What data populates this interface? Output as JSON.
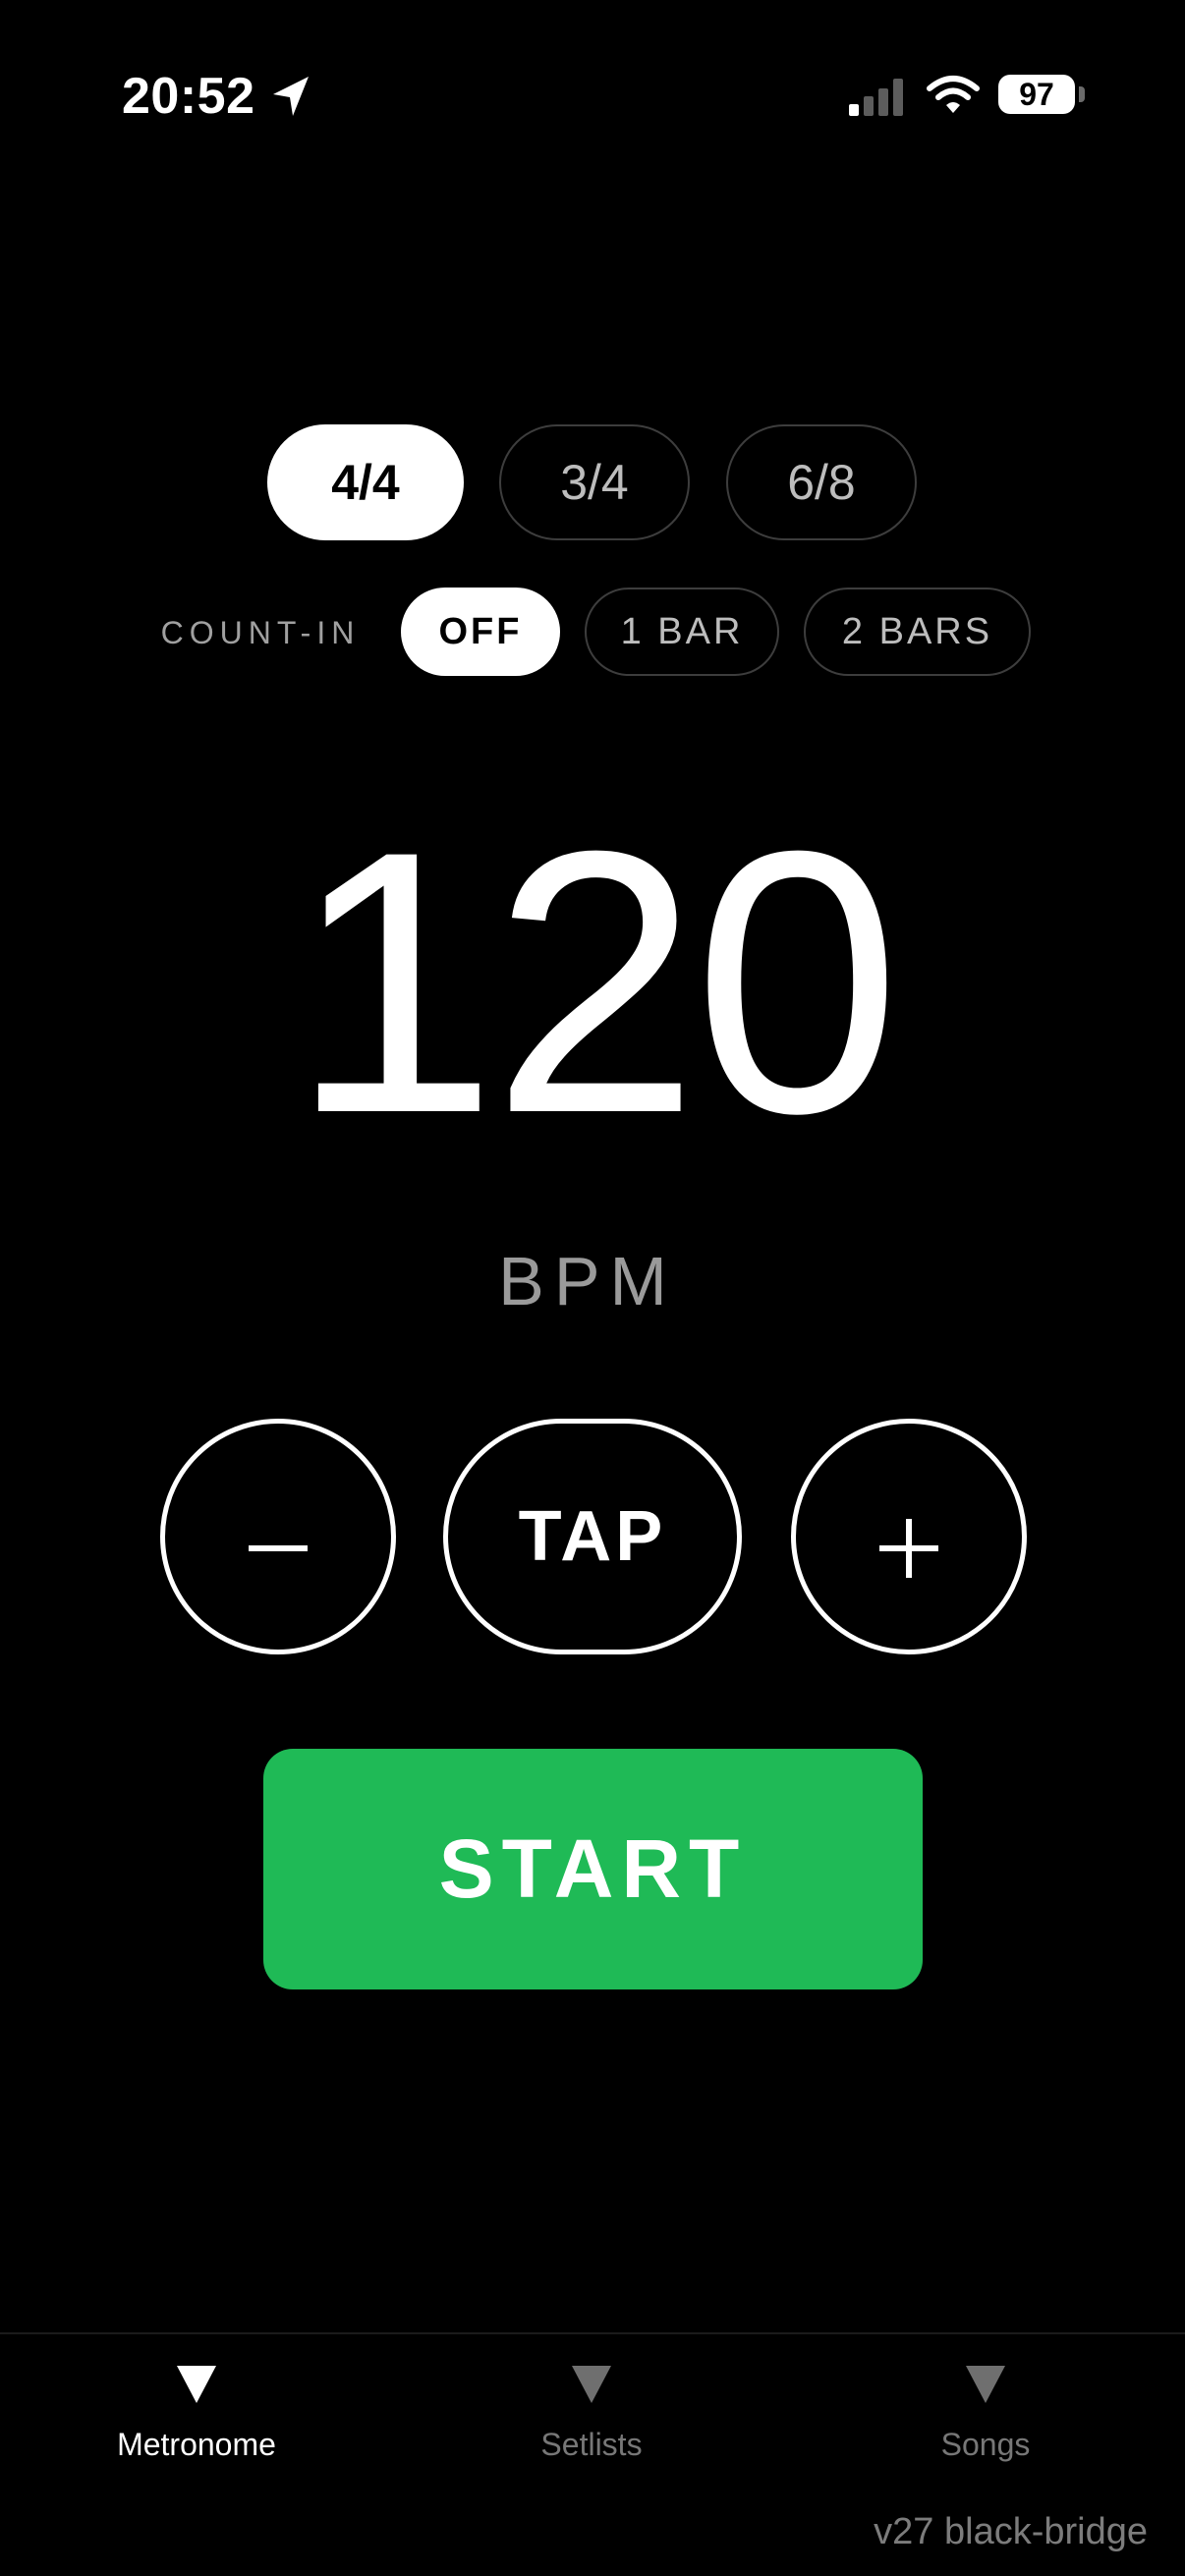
{
  "status_bar": {
    "time": "20:52",
    "battery": "97"
  },
  "time_signatures": {
    "options": [
      "4/4",
      "3/4",
      "6/8"
    ],
    "selected": "4/4"
  },
  "count_in": {
    "label": "COUNT-IN",
    "options": [
      "OFF",
      "1 BAR",
      "2 BARS"
    ],
    "selected": "OFF"
  },
  "tempo": {
    "bpm": "120",
    "unit": "BPM"
  },
  "controls": {
    "tap_label": "TAP",
    "start_label": "START",
    "start_color": "#1fba56"
  },
  "tab_bar": {
    "items": [
      {
        "label": "Metronome",
        "icon": "triangle-down-icon",
        "active": true
      },
      {
        "label": "Setlists",
        "icon": "triangle-down-icon",
        "active": false
      },
      {
        "label": "Songs",
        "icon": "triangle-down-icon",
        "active": false
      }
    ]
  },
  "footer": {
    "version": "v27 black-bridge"
  }
}
